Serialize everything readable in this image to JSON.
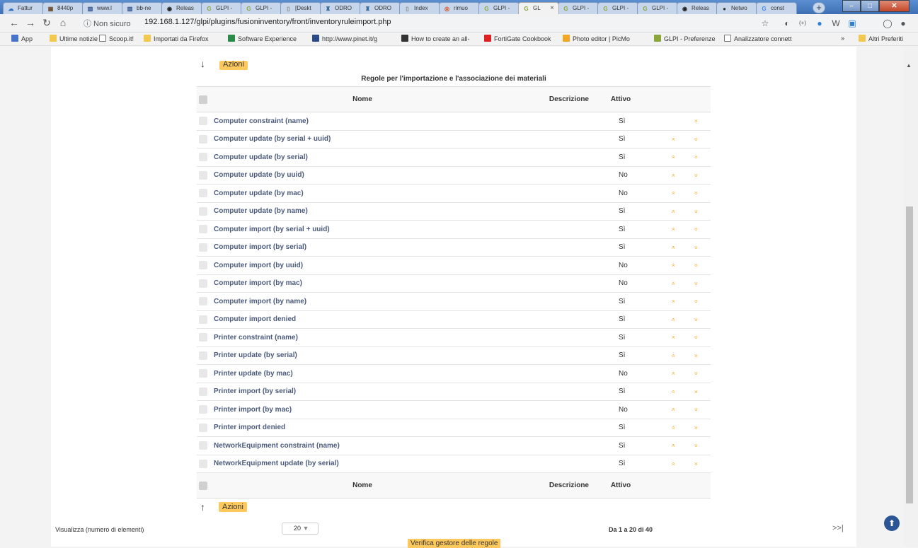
{
  "browser": {
    "tabs": [
      {
        "label": "Fattur",
        "icon": "cloud-icon"
      },
      {
        "label": "8440p",
        "icon": "store-icon"
      },
      {
        "label": "www.l",
        "icon": "chart-icon"
      },
      {
        "label": "bb-ne",
        "icon": "chart-icon"
      },
      {
        "label": "Releas",
        "icon": "github-icon"
      },
      {
        "label": "GLPI -",
        "icon": "glpi-icon"
      },
      {
        "label": "GLPI -",
        "icon": "glpi-icon"
      },
      {
        "label": "[Deskt",
        "icon": "page-icon"
      },
      {
        "label": "ODRO",
        "icon": "odro-icon"
      },
      {
        "label": "ODRO",
        "icon": "odro-icon"
      },
      {
        "label": "Index",
        "icon": "page-icon"
      },
      {
        "label": "rimuo",
        "icon": "ubuntu-icon"
      },
      {
        "label": "GLPI -",
        "icon": "glpi-icon"
      },
      {
        "label": "GL",
        "icon": "glpi-icon",
        "active": true
      },
      {
        "label": "GLPI -",
        "icon": "glpi-icon"
      },
      {
        "label": "GLPI -",
        "icon": "glpi-icon"
      },
      {
        "label": "GLPI -",
        "icon": "glpi-icon"
      },
      {
        "label": "Releas",
        "icon": "github-icon"
      },
      {
        "label": "Netwo",
        "icon": "network-icon"
      },
      {
        "label": "const",
        "icon": "google-icon"
      }
    ],
    "tab_close": "×",
    "new_tab": "+",
    "security_label": "ⓘ Non sicuro",
    "url": "192.168.1.127/glpi/plugins/fusioninventory/front/inventoryruleimport.php",
    "bookmarks": [
      {
        "label": "App",
        "icon": "apps-icon"
      },
      {
        "label": "Ultime notizie",
        "icon": "folder-icon"
      },
      {
        "label": "Scoop.it!",
        "icon": "page-icon"
      },
      {
        "label": "Importati da Firefox",
        "icon": "folder-icon"
      },
      {
        "label": "Software Experience",
        "icon": "dash-icon"
      },
      {
        "label": "http://www.pinet.it/g",
        "icon": "grid-icon"
      },
      {
        "label": "How to create an all-",
        "icon": "wave-icon"
      },
      {
        "label": "FortiGate Cookbook",
        "icon": "youtube-icon"
      },
      {
        "label": "Photo editor | PicMo",
        "icon": "picmonkey-icon"
      },
      {
        "label": "GLPI - Preferenze",
        "icon": "glpi-icon"
      },
      {
        "label": "Analizzatore connett",
        "icon": "page-icon"
      }
    ],
    "bookmarks_more": "»",
    "other_bookmarks": "Altri Preferiti"
  },
  "page": {
    "actions_label": "Azioni",
    "table_title": "Regole per l'importazione e l'associazione dei materiali",
    "headers": {
      "name": "Nome",
      "description": "Descrizione",
      "active": "Attivo"
    },
    "rules": [
      {
        "name": "Computer constraint (name)",
        "active": "Sì",
        "up": "",
        "down": "»"
      },
      {
        "name": "Computer update (by serial + uuid)",
        "active": "Sì",
        "up": "«",
        "down": "»"
      },
      {
        "name": "Computer update (by serial)",
        "active": "Sì",
        "up": "«",
        "down": "»"
      },
      {
        "name": "Computer update (by uuid)",
        "active": "No",
        "up": "«",
        "down": "»"
      },
      {
        "name": "Computer update (by mac)",
        "active": "No",
        "up": "«",
        "down": "»"
      },
      {
        "name": "Computer update (by name)",
        "active": "Sì",
        "up": "«",
        "down": "»"
      },
      {
        "name": "Computer import (by serial + uuid)",
        "active": "Sì",
        "up": "«",
        "down": "»"
      },
      {
        "name": "Computer import (by serial)",
        "active": "Sì",
        "up": "«",
        "down": "»"
      },
      {
        "name": "Computer import (by uuid)",
        "active": "No",
        "up": "«",
        "down": "»"
      },
      {
        "name": "Computer import (by mac)",
        "active": "No",
        "up": "«",
        "down": "»"
      },
      {
        "name": "Computer import (by name)",
        "active": "Sì",
        "up": "«",
        "down": "»"
      },
      {
        "name": "Computer import denied",
        "active": "Sì",
        "up": "«",
        "down": "»"
      },
      {
        "name": "Printer constraint (name)",
        "active": "Sì",
        "up": "«",
        "down": "»"
      },
      {
        "name": "Printer update (by serial)",
        "active": "Sì",
        "up": "«",
        "down": "»"
      },
      {
        "name": "Printer update (by mac)",
        "active": "No",
        "up": "«",
        "down": "»"
      },
      {
        "name": "Printer import (by serial)",
        "active": "Sì",
        "up": "«",
        "down": "»"
      },
      {
        "name": "Printer import (by mac)",
        "active": "No",
        "up": "«",
        "down": "»"
      },
      {
        "name": "Printer import denied",
        "active": "Sì",
        "up": "«",
        "down": "»"
      },
      {
        "name": "NetworkEquipment constraint (name)",
        "active": "Sì",
        "up": "«",
        "down": "»"
      },
      {
        "name": "NetworkEquipment update (by serial)",
        "active": "Sì",
        "up": "«",
        "down": "»"
      }
    ],
    "pager_label": "Visualizza (numero di elementi)",
    "pager_value": "20",
    "pager_info": "Da 1 a 20 di 40",
    "pager_next": ">>|",
    "verify_button": "Verifica gestore delle regole"
  },
  "colors": {
    "accent": "#fec95c",
    "link": "#4b5a7c",
    "arrows": "#f0b643",
    "tabstrip": "#3e6fb4"
  }
}
